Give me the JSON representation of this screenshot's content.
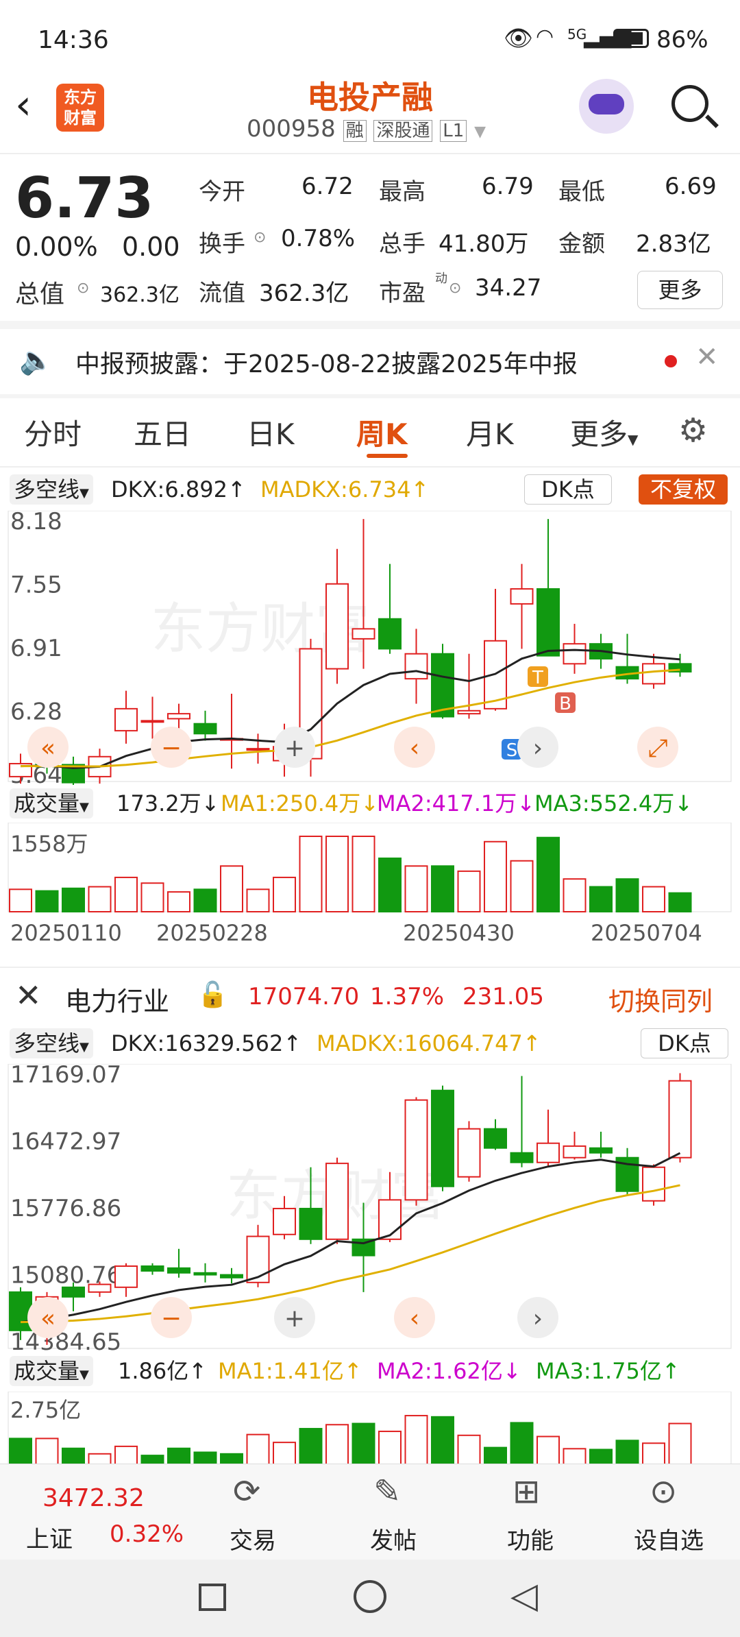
{
  "status": {
    "time": "14:36",
    "battery": "86%",
    "network": "5G"
  },
  "header": {
    "title": "电投产融",
    "code": "000958",
    "badges": [
      "融",
      "深股通",
      "L1"
    ],
    "logo_text": "东方财富"
  },
  "quote": {
    "price": "6.73",
    "change_pct": "0.00%",
    "change": "0.00",
    "open_label": "今开",
    "open": "6.72",
    "high_label": "最高",
    "high": "6.79",
    "low_label": "最低",
    "low": "6.69",
    "turnover_label": "换手",
    "turnover": "0.78%",
    "volume_label": "总手",
    "volume": "41.80万",
    "amount_label": "金额",
    "amount": "2.83亿",
    "mktcap_label": "总值",
    "mktcap": "362.3亿",
    "float_label": "流值",
    "float": "362.3亿",
    "pe_label": "市盈",
    "pe_sup": "动",
    "pe": "34.27",
    "more_label": "更多"
  },
  "notice": {
    "text": "中报预披露：于2025-08-22披露2025年中报"
  },
  "tabs": [
    "分时",
    "五日",
    "日K",
    "周K",
    "月K",
    "更多"
  ],
  "active_tab": "周K",
  "colors": {
    "up": "#e02020",
    "down": "#119911",
    "accent": "#e06000",
    "dkx": "#222222",
    "madkx": "#e0b000",
    "ma2": "#cc00cc"
  },
  "chart1": {
    "indicator": "多空线",
    "dkx_label": "DKX:6.892↑",
    "madkx_label": "MADKX:6.734↑",
    "dk_btn": "DK点",
    "adjust_btn": "不复权",
    "y_ticks": [
      "8.18",
      "7.55",
      "6.91",
      "6.28",
      "5.64"
    ],
    "vol_label": "成交量",
    "vol_value": "173.2万↓",
    "ma1": "MA1:250.4万↓",
    "ma2": "MA2:417.1万↓",
    "ma3": "MA3:552.4万↓",
    "vol_max": "1558万",
    "x_ticks": [
      "20250110",
      "20250228",
      "20250430",
      "20250704"
    ],
    "markers": [
      "T",
      "B",
      "S"
    ]
  },
  "chart2": {
    "industry": "电力行业",
    "value": "17074.70",
    "pct": "1.37%",
    "chg": "231.05",
    "switch": "切换同列",
    "indicator": "多空线",
    "dkx_label": "DKX:16329.562↑",
    "madkx_label": "MADKX:16064.747↑",
    "dk_btn": "DK点",
    "y_ticks": [
      "17169.07",
      "16472.97",
      "15776.86",
      "15080.76",
      "14384.65"
    ],
    "vol_label": "成交量",
    "vol_value": "1.86亿↑",
    "ma1": "MA1:1.41亿↑",
    "ma2": "MA2:1.62亿↓",
    "ma3": "MA3:1.75亿↑",
    "vol_max": "2.75亿"
  },
  "chart_data": [
    {
      "type": "candlestick",
      "title": "电投产融 周K",
      "ylim": [
        5.64,
        8.18
      ],
      "candles": [
        {
          "o": 5.62,
          "c": 5.75,
          "h": 5.85,
          "l": 5.55
        },
        {
          "o": 5.85,
          "c": 5.72,
          "h": 5.92,
          "l": 5.65
        },
        {
          "o": 5.74,
          "c": 5.56,
          "h": 5.82,
          "l": 5.5
        },
        {
          "o": 5.62,
          "c": 5.82,
          "h": 5.9,
          "l": 5.55
        },
        {
          "o": 6.08,
          "c": 6.3,
          "h": 6.48,
          "l": 5.95
        },
        {
          "o": 6.18,
          "c": 6.18,
          "h": 6.42,
          "l": 6.0
        },
        {
          "o": 6.2,
          "c": 6.25,
          "h": 6.35,
          "l": 6.1
        },
        {
          "o": 6.15,
          "c": 6.05,
          "h": 6.28,
          "l": 5.98
        },
        {
          "o": 6.0,
          "c": 6.0,
          "h": 6.45,
          "l": 5.7
        },
        {
          "o": 5.9,
          "c": 5.9,
          "h": 6.05,
          "l": 5.75
        },
        {
          "o": 5.78,
          "c": 5.92,
          "h": 6.15,
          "l": 5.62
        },
        {
          "o": 5.8,
          "c": 6.9,
          "h": 7.0,
          "l": 5.62
        },
        {
          "o": 6.7,
          "c": 7.55,
          "h": 7.9,
          "l": 6.55
        },
        {
          "o": 7.0,
          "c": 7.1,
          "h": 8.2,
          "l": 6.7
        },
        {
          "o": 7.2,
          "c": 6.9,
          "h": 7.75,
          "l": 6.85
        },
        {
          "o": 6.6,
          "c": 6.85,
          "h": 7.1,
          "l": 6.35
        },
        {
          "o": 6.85,
          "c": 6.22,
          "h": 6.95,
          "l": 6.2
        },
        {
          "o": 6.25,
          "c": 6.28,
          "h": 6.85,
          "l": 6.2
        },
        {
          "o": 6.3,
          "c": 6.98,
          "h": 7.5,
          "l": 6.28
        },
        {
          "o": 7.35,
          "c": 7.5,
          "h": 7.75,
          "l": 6.9
        },
        {
          "o": 7.5,
          "c": 6.83,
          "h": 8.2,
          "l": 6.9
        },
        {
          "o": 6.75,
          "c": 6.95,
          "h": 7.15,
          "l": 6.65
        },
        {
          "o": 6.95,
          "c": 6.8,
          "h": 7.05,
          "l": 6.7
        },
        {
          "o": 6.72,
          "c": 6.6,
          "h": 7.05,
          "l": 6.55
        },
        {
          "o": 6.55,
          "c": 6.75,
          "h": 6.85,
          "l": 6.5
        },
        {
          "o": 6.75,
          "c": 6.67,
          "h": 6.85,
          "l": 6.62
        }
      ],
      "volume_max": 1558
    },
    {
      "type": "candlestick",
      "title": "电力行业 周K",
      "ylim": [
        14384.65,
        17169.07
      ],
      "candles": [
        {
          "o": 14900,
          "c": 14500,
          "h": 14950,
          "l": 14400
        },
        {
          "o": 14500,
          "c": 14850,
          "h": 14900,
          "l": 14350
        },
        {
          "o": 14950,
          "c": 14850,
          "h": 15000,
          "l": 14700
        },
        {
          "o": 14900,
          "c": 14980,
          "h": 15010,
          "l": 14850
        },
        {
          "o": 14950,
          "c": 15170,
          "h": 15200,
          "l": 14850
        },
        {
          "o": 15170,
          "c": 15120,
          "h": 15200,
          "l": 15080
        },
        {
          "o": 15150,
          "c": 15100,
          "h": 15350,
          "l": 15050
        },
        {
          "o": 15100,
          "c": 15080,
          "h": 15200,
          "l": 15000
        },
        {
          "o": 15080,
          "c": 15050,
          "h": 15150,
          "l": 14990
        },
        {
          "o": 15000,
          "c": 15480,
          "h": 15600,
          "l": 14950
        },
        {
          "o": 15500,
          "c": 15770,
          "h": 15900,
          "l": 15450
        },
        {
          "o": 15770,
          "c": 15450,
          "h": 16200,
          "l": 15400
        },
        {
          "o": 15450,
          "c": 16240,
          "h": 16300,
          "l": 15400
        },
        {
          "o": 15450,
          "c": 15280,
          "h": 15830,
          "l": 14900
        },
        {
          "o": 15450,
          "c": 15860,
          "h": 16150,
          "l": 15420
        },
        {
          "o": 15860,
          "c": 16900,
          "h": 16930,
          "l": 15800
        },
        {
          "o": 17000,
          "c": 16000,
          "h": 17050,
          "l": 15950
        },
        {
          "o": 16100,
          "c": 16600,
          "h": 16680,
          "l": 16050
        },
        {
          "o": 16600,
          "c": 16400,
          "h": 16700,
          "l": 16380
        },
        {
          "o": 16350,
          "c": 16250,
          "h": 17150,
          "l": 16200
        },
        {
          "o": 16250,
          "c": 16450,
          "h": 16800,
          "l": 16200
        },
        {
          "o": 16300,
          "c": 16420,
          "h": 16570,
          "l": 16280
        },
        {
          "o": 16400,
          "c": 16350,
          "h": 16570,
          "l": 16300
        },
        {
          "o": 16300,
          "c": 15950,
          "h": 16400,
          "l": 15900
        },
        {
          "o": 15850,
          "c": 16200,
          "h": 16230,
          "l": 15800
        },
        {
          "o": 16300,
          "c": 17100,
          "h": 17180,
          "l": 16250
        }
      ],
      "volume_max": 2.75
    }
  ],
  "bottom": {
    "index_value": "3472.32",
    "index_name": "上证",
    "index_pct": "0.32%",
    "items": [
      "交易",
      "发帖",
      "功能",
      "设自选"
    ]
  }
}
